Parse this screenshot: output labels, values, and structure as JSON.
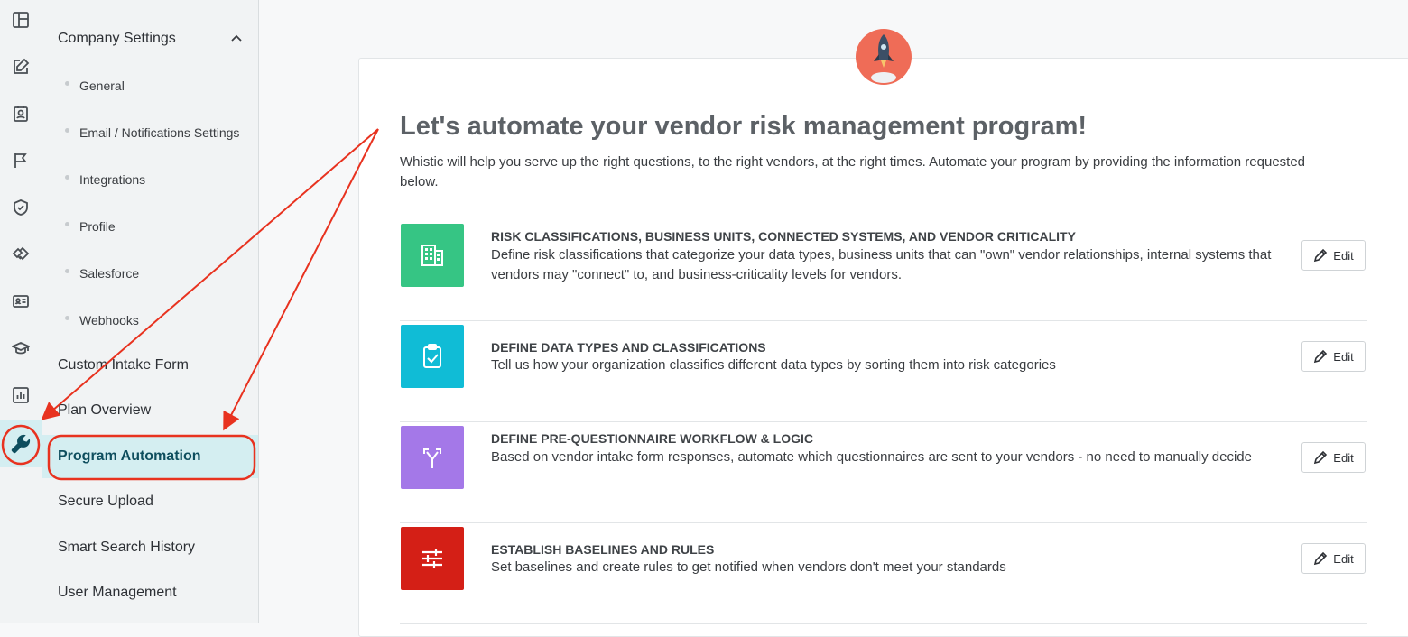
{
  "rail": {
    "icons": [
      "layout-icon",
      "edit-icon",
      "contact-card-icon",
      "flag-icon",
      "shield-check-icon",
      "handshake-icon",
      "id-card-icon",
      "graduation-cap-icon",
      "bar-chart-icon",
      "wrench-icon"
    ]
  },
  "subnav": {
    "section_title": "Company Settings",
    "sub_items": [
      {
        "label": "General"
      },
      {
        "label": "Email / Notifications Settings"
      },
      {
        "label": "Integrations"
      },
      {
        "label": "Profile"
      },
      {
        "label": "Salesforce"
      },
      {
        "label": "Webhooks"
      }
    ],
    "items": [
      {
        "label": "Custom Intake Form"
      },
      {
        "label": "Plan Overview"
      },
      {
        "label": "Program Automation"
      },
      {
        "label": "Secure Upload"
      },
      {
        "label": "Smart Search History"
      },
      {
        "label": "User Management"
      }
    ]
  },
  "main": {
    "title": "Let's automate your vendor risk management program!",
    "intro": "Whistic will help you serve up the right questions, to the right vendors, at the right times. Automate your program by providing the information requested below.",
    "edit_label": "Edit",
    "rows": [
      {
        "title": "RISK CLASSIFICATIONS, BUSINESS UNITS, CONNECTED SYSTEMS, AND VENDOR CRITICALITY",
        "description": "Define risk classifications that categorize your data types, business units that can \"own\" vendor relationships, internal systems that vendors may \"connect\" to, and business-criticality levels for vendors.",
        "icon": "building-icon",
        "color": "#36c584"
      },
      {
        "title": "DEFINE DATA TYPES AND CLASSIFICATIONS",
        "description": "Tell us how your organization classifies different data types by sorting them into risk categories",
        "icon": "clipboard-check-icon",
        "color": "#10bcd6"
      },
      {
        "title": "DEFINE PRE-QUESTIONNAIRE WORKFLOW & LOGIC",
        "description": "Based on vendor intake form responses, automate which questionnaires are sent to your vendors - no need to manually decide",
        "icon": "merge-arrows-icon",
        "color": "#a478e8"
      },
      {
        "title": "ESTABLISH BASELINES AND RULES",
        "description": "Set baselines and create rules to get notified when vendors don't meet your standards",
        "icon": "sliders-icon",
        "color": "#d41f16"
      }
    ]
  },
  "colors": {
    "accent": "#0e4e5e",
    "active_bg": "#d4eef1",
    "annotation": "#e8321f"
  }
}
